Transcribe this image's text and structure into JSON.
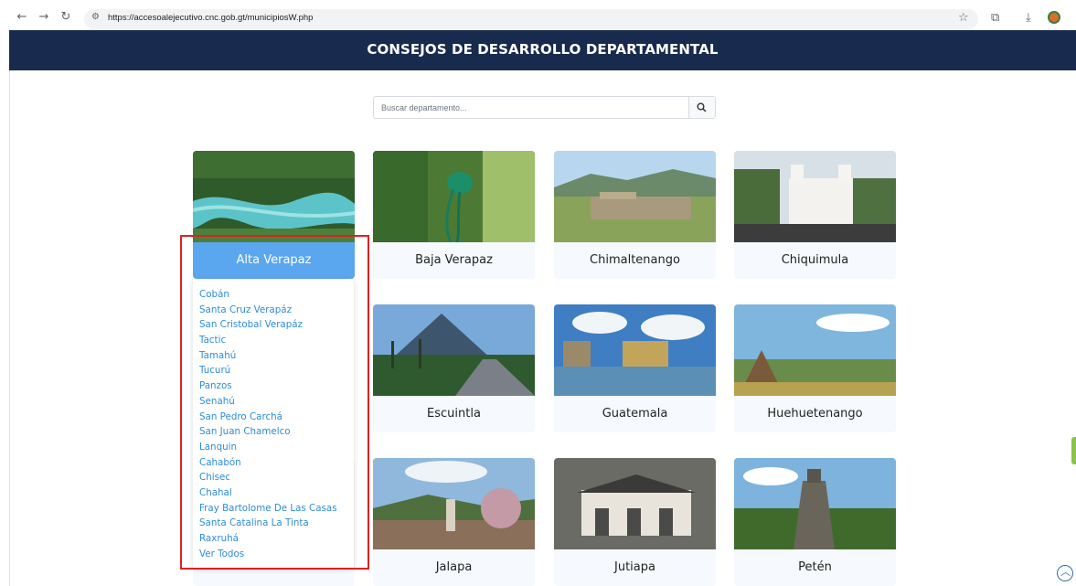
{
  "browser": {
    "url": "https://accesoalejecutivo.cnc.gob.gt/municipiosW.php"
  },
  "header": {
    "title": "CONSEJOS DE DESARROLLO DEPARTAMENTAL"
  },
  "search": {
    "placeholder": "Buscar departamento...",
    "value": ""
  },
  "departments": [
    {
      "name": "Alta Verapaz",
      "active": true
    },
    {
      "name": "Baja Verapaz"
    },
    {
      "name": "Chimaltenango"
    },
    {
      "name": "Chiquimula"
    },
    {
      "name": "Escuintla"
    },
    {
      "name": "Guatemala"
    },
    {
      "name": "Huehuetenango"
    },
    {
      "name": "Jalapa"
    },
    {
      "name": "Jutiapa"
    },
    {
      "name": "Petén"
    }
  ],
  "dropdown": {
    "items": [
      "Cobán",
      "Santa Cruz Verapáz",
      "San Cristobal Verapáz",
      "Tactic",
      "Tamahú",
      "Tucurú",
      "Panzos",
      "Senahú",
      "San Pedro Carchá",
      "San Juan Chamelco",
      "Lanquin",
      "Cahabón",
      "Chisec",
      "Chahal",
      "Fray Bartolome De Las Casas",
      "Santa Catalina La Tinta",
      "Raxruhá",
      "Ver Todos"
    ]
  },
  "colors": {
    "banner": "#182a4e",
    "active_card": "#5aa6ef",
    "link": "#2f8bd8",
    "highlight": "#e02020"
  }
}
